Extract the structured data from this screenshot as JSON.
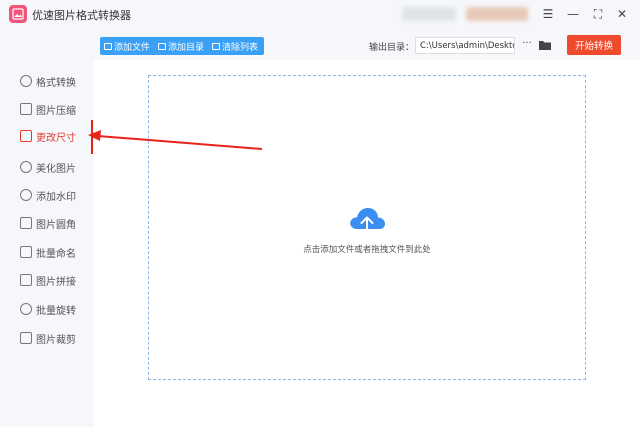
{
  "app": {
    "title": "优速图片格式转换器",
    "logo_icon": "image-icon"
  },
  "window_controls": {
    "menu": "☰",
    "minimize": "—",
    "maximize": "⛶",
    "close": "✕"
  },
  "sidebar": {
    "items": [
      {
        "label": "格式转换",
        "icon": "convert-icon",
        "active": false
      },
      {
        "label": "图片压缩",
        "icon": "compress-icon",
        "active": false
      },
      {
        "label": "更改尺寸",
        "icon": "resize-icon",
        "active": true
      },
      {
        "label": "美化图片",
        "icon": "beautify-icon",
        "active": false
      },
      {
        "label": "添加水印",
        "icon": "watermark-icon",
        "active": false
      },
      {
        "label": "图片圆角",
        "icon": "round-corner-icon",
        "active": false
      },
      {
        "label": "批量命名",
        "icon": "rename-icon",
        "active": false
      },
      {
        "label": "图片拼接",
        "icon": "stitch-icon",
        "active": false
      },
      {
        "label": "批量旋转",
        "icon": "rotate-icon",
        "active": false
      },
      {
        "label": "图片裁剪",
        "icon": "crop-icon",
        "active": false
      }
    ]
  },
  "toolbar": {
    "add_file": "添加文件",
    "add_folder": "添加目录",
    "clear_list": "清除列表"
  },
  "output": {
    "label": "输出目录：",
    "path": "C:\\Users\\admin\\Deskto",
    "more": "···"
  },
  "start_button": "开始转换",
  "dropzone": {
    "hint": "点击添加文件或者拖拽文件到此处",
    "icon": "cloud-upload-icon"
  },
  "colors": {
    "accent_blue": "#3aa0f5",
    "start_red": "#f04a2c",
    "active_red": "#e03a2f",
    "annotation_arrow": "#e8231a"
  }
}
